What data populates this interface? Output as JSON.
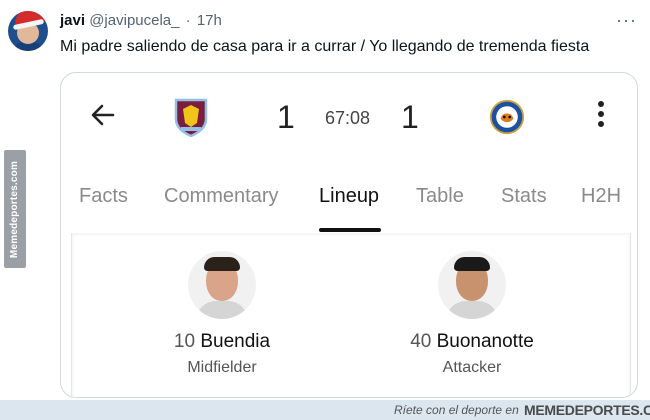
{
  "tweet": {
    "author_name": "javi",
    "author_handle": "@javipucela_",
    "separator": "·",
    "time": "17h",
    "text": "Mi padre saliendo de casa para ir a currar / Yo llegando de tremenda fiesta"
  },
  "watermark": {
    "side": "Memedeportes.com",
    "tagline": "Ríete con el deporte en",
    "brand": "MEMEDEPORTES.COM"
  },
  "match": {
    "home_score": "1",
    "clock": "67:08",
    "away_score": "1",
    "home_crest_color": "#7a1d3f",
    "away_crest_color": "#1d4fa3"
  },
  "tabs": [
    {
      "label": "Facts",
      "active": false
    },
    {
      "label": "Commentary",
      "active": false
    },
    {
      "label": "Lineup",
      "active": true
    },
    {
      "label": "Table",
      "active": false
    },
    {
      "label": "Stats",
      "active": false
    },
    {
      "label": "H2H",
      "active": false
    }
  ],
  "players": [
    {
      "number": "10",
      "name": "Buendia",
      "position": "Midfielder"
    },
    {
      "number": "40",
      "name": "Buonanotte",
      "position": "Attacker"
    }
  ]
}
